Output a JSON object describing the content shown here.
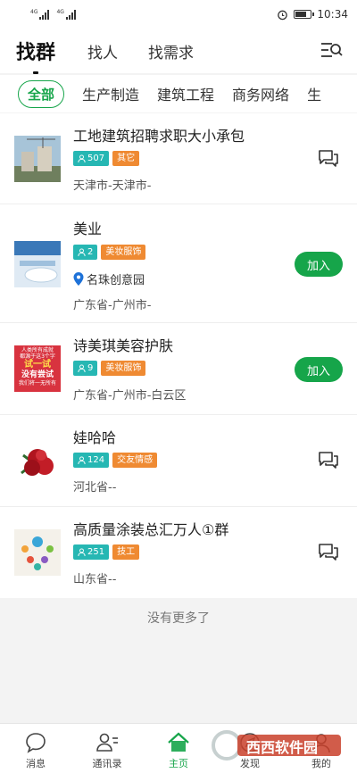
{
  "status": {
    "net1": "4G",
    "net2": "4G",
    "time": "10:34",
    "battery": 0.75
  },
  "top_tabs": [
    {
      "label": "找群",
      "active": true
    },
    {
      "label": "找人"
    },
    {
      "label": "找需求"
    }
  ],
  "categories": [
    "全部",
    "生产制造",
    "建筑工程",
    "商务网络",
    "生"
  ],
  "groups": [
    {
      "title": "工地建筑招聘求职大小承包",
      "members": "507",
      "tag": "其它",
      "region": "天津市-天津市-",
      "action": "chat"
    },
    {
      "title": "美业",
      "members": "2",
      "tag": "美妆服饰",
      "place": "名珠创意园",
      "region": "广东省-广州市-",
      "action": "join",
      "action_label": "加入"
    },
    {
      "title": "诗美琪美容护肤",
      "members": "9",
      "tag": "美妆服饰",
      "region": "广东省-广州市-白云区",
      "action": "join",
      "action_label": "加入"
    },
    {
      "title": "娃哈哈",
      "members": "124",
      "tag": "交友情感",
      "region": "河北省--",
      "action": "chat"
    },
    {
      "title": "高质量涂装总汇万人①群",
      "members": "251",
      "tag": "技工",
      "region": "山东省--",
      "action": "chat"
    }
  ],
  "thumb3_text": {
    "line1": "人类所有成就",
    "line2": "都源于这3个字",
    "big1": "试一试",
    "big2": "没有尝试",
    "line3": "我们将一无所有"
  },
  "no_more": "没有更多了",
  "tabbar": [
    {
      "label": "消息"
    },
    {
      "label": "通讯录"
    },
    {
      "label": "主页",
      "active": true
    },
    {
      "label": "发现"
    },
    {
      "label": "我的"
    }
  ],
  "watermark": "西西软件园",
  "colors": {
    "accent": "#16a54a",
    "teal": "#26b7b3",
    "orange": "#ef8a32"
  }
}
